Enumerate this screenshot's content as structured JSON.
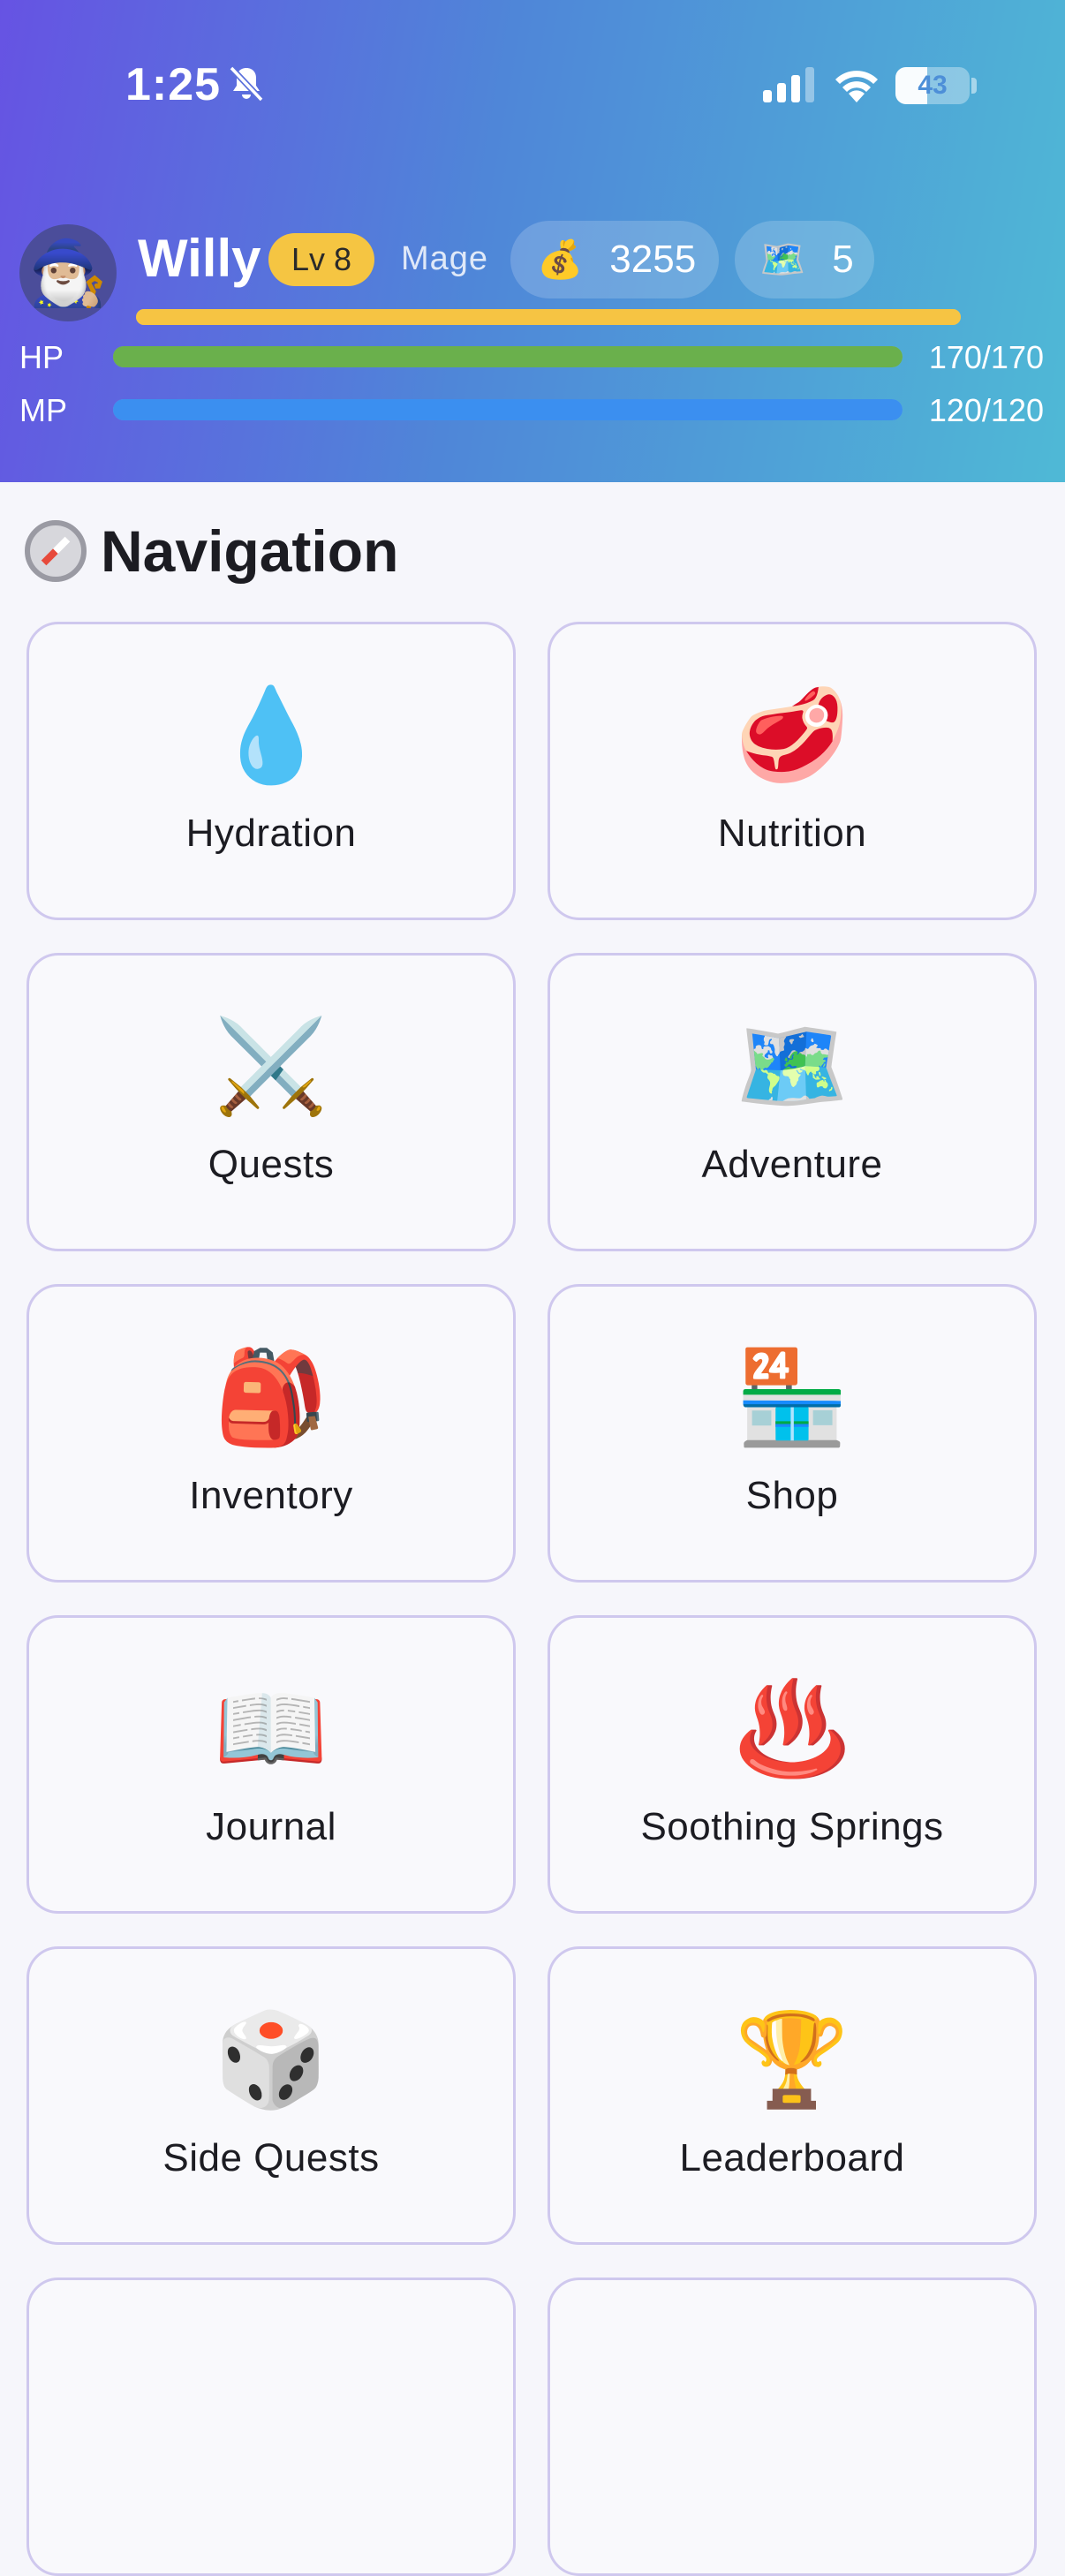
{
  "status_bar": {
    "time": "1:25",
    "battery_level": "43",
    "battery_fraction": 0.43,
    "icons": [
      "bell-slash-icon",
      "signal-icon",
      "wifi-icon",
      "battery-icon"
    ]
  },
  "player": {
    "avatar_icon": "wizard-icon",
    "avatar_emoji": "🧙🏼‍♂️",
    "name": "Willy",
    "level_label": "Lv 8",
    "class_name": "Mage",
    "gold_icon": "money-bag-icon",
    "gold_emoji": "💰",
    "gold": "3255",
    "maps_icon": "map-icon",
    "maps_emoji": "🗺️",
    "maps": "5",
    "xp_fraction": 1.0
  },
  "stats": {
    "hp": {
      "label": "HP",
      "value": "170/170",
      "fraction": 1.0,
      "color": "#6ab04c"
    },
    "mp": {
      "label": "MP",
      "value": "120/120",
      "fraction": 1.0,
      "color": "#3b8ff0"
    }
  },
  "navigation": {
    "title": "Navigation",
    "title_icon": "compass-icon",
    "items": [
      {
        "label": "Hydration",
        "icon": "droplet-icon",
        "emoji": "💧"
      },
      {
        "label": "Nutrition",
        "icon": "steak-icon",
        "emoji": "🥩"
      },
      {
        "label": "Quests",
        "icon": "crossed-swords-icon",
        "emoji": "⚔️"
      },
      {
        "label": "Adventure",
        "icon": "map-icon",
        "emoji": "🗺️"
      },
      {
        "label": "Inventory",
        "icon": "backpack-icon",
        "emoji": "🎒"
      },
      {
        "label": "Shop",
        "icon": "store-icon",
        "emoji": "🏪"
      },
      {
        "label": "Journal",
        "icon": "open-book-icon",
        "emoji": "📖"
      },
      {
        "label": "Soothing Springs",
        "icon": "hot-springs-icon",
        "emoji": "♨️"
      },
      {
        "label": "Side Quests",
        "icon": "dice-icon",
        "emoji": "🎲"
      },
      {
        "label": "Leaderboard",
        "icon": "trophy-icon",
        "emoji": "🏆"
      }
    ]
  },
  "colors": {
    "header_gradient_start": "#6653e3",
    "header_gradient_end": "#4fb9d6",
    "level_badge": "#f5c542",
    "xp_bar": "#f6c443",
    "card_border": "#cfc8ee",
    "page_background": "#f6f6fb"
  }
}
